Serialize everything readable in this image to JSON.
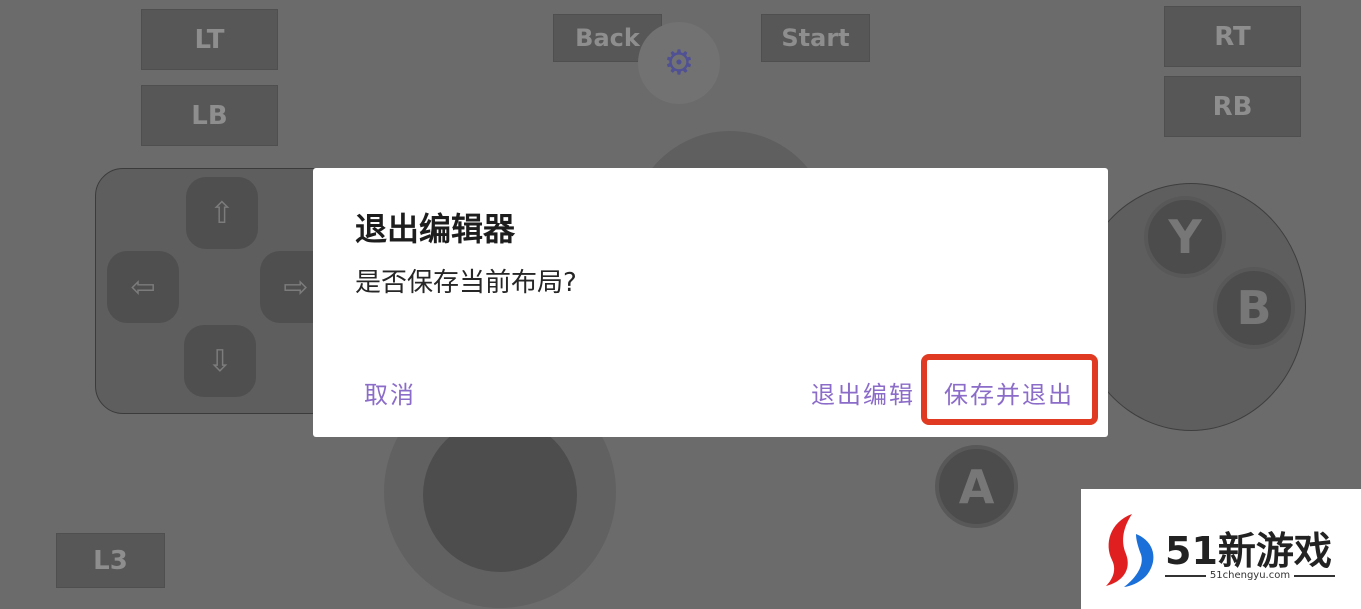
{
  "controller": {
    "lt": "LT",
    "lb": "LB",
    "rt": "RT",
    "rb": "RB",
    "back": "Back",
    "start": "Start",
    "l3": "L3",
    "y": "Y",
    "b": "B",
    "a": "A",
    "dpad": {
      "up": "⇧",
      "left": "⇦",
      "right": "⇨",
      "down": "⇩"
    },
    "settings_icon": "⚙"
  },
  "dialog": {
    "title": "退出编辑器",
    "message": "是否保存当前布局?",
    "cancel": "取消",
    "exit_edit": "退出编辑",
    "save_and_exit": "保存并退出"
  },
  "colors": {
    "accent": "#8b6cc8",
    "highlight": "#e03b22",
    "overlay": "#6b6b6b"
  },
  "watermark": {
    "brand": "51新游戏",
    "url": "51chengyu.com"
  }
}
